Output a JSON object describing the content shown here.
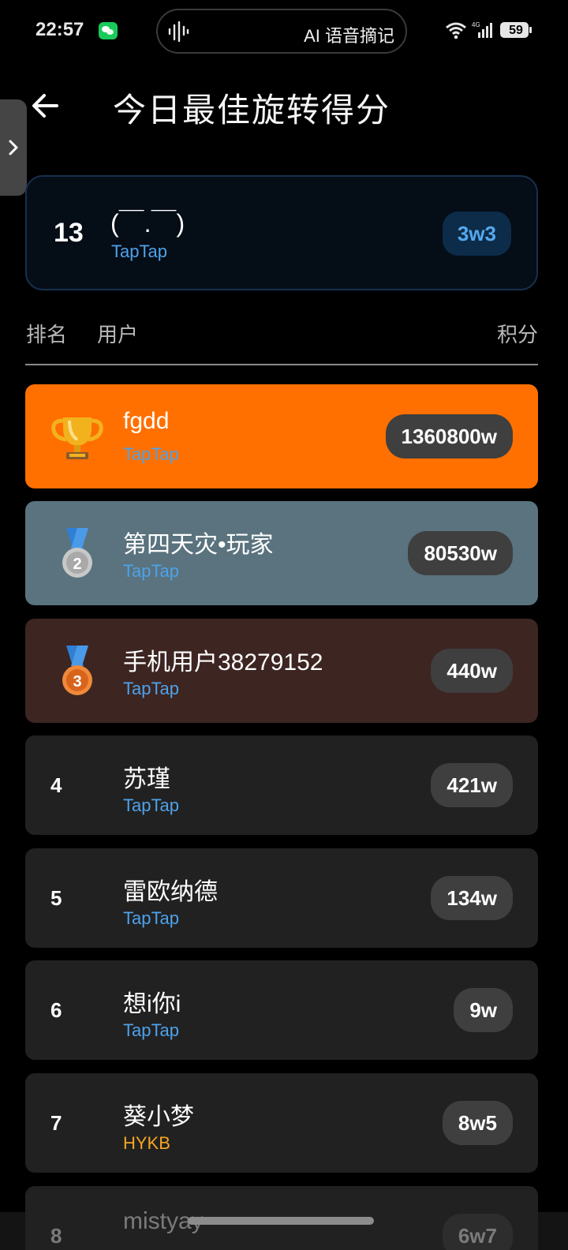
{
  "status_bar": {
    "time": "22:57",
    "voice_pill_text": "AI 语音摘记",
    "network": "4G",
    "battery": "59"
  },
  "header": {
    "title": "今日最佳旋转得分"
  },
  "my_entry": {
    "rank": "13",
    "name": "(￣.￣)",
    "platform": "TapTap",
    "score": "3w3"
  },
  "columns": {
    "rank": "排名",
    "user": "用户",
    "score": "积分"
  },
  "rows": [
    {
      "rank": "1",
      "name": "fgdd",
      "platform": "TapTap",
      "score": "1360800w",
      "medal": "trophy-icon",
      "bg": "#ff7000",
      "platform_color": "#4ea2ea"
    },
    {
      "rank": "2",
      "name": "第四天灾•玩家",
      "platform": "TapTap",
      "score": "80530w",
      "medal": "silver-medal-icon",
      "bg": "#5a737e",
      "platform_color": "#4ea2ea"
    },
    {
      "rank": "3",
      "name": "手机用户38279152",
      "platform": "TapTap",
      "score": "440w",
      "medal": "bronze-medal-icon",
      "bg": "#3d2522",
      "platform_color": "#4ea2ea"
    },
    {
      "rank": "4",
      "name": "苏瑾",
      "platform": "TapTap",
      "score": "421w",
      "bg": "#212121",
      "platform_color": "#4ea2ea"
    },
    {
      "rank": "5",
      "name": "雷欧纳德",
      "platform": "TapTap",
      "score": "134w",
      "bg": "#212121",
      "platform_color": "#4ea2ea"
    },
    {
      "rank": "6",
      "name": "想i你i",
      "platform": "TapTap",
      "score": "9w",
      "bg": "#212121",
      "platform_color": "#4ea2ea"
    },
    {
      "rank": "7",
      "name": "葵小梦",
      "platform": "HYKB",
      "score": "8w5",
      "bg": "#212121",
      "platform_color": "#f5a623"
    },
    {
      "rank": "8",
      "name": "mistyay",
      "platform": "",
      "score": "6w7",
      "bg": "#212121",
      "platform_color": "#4ea2ea"
    }
  ]
}
